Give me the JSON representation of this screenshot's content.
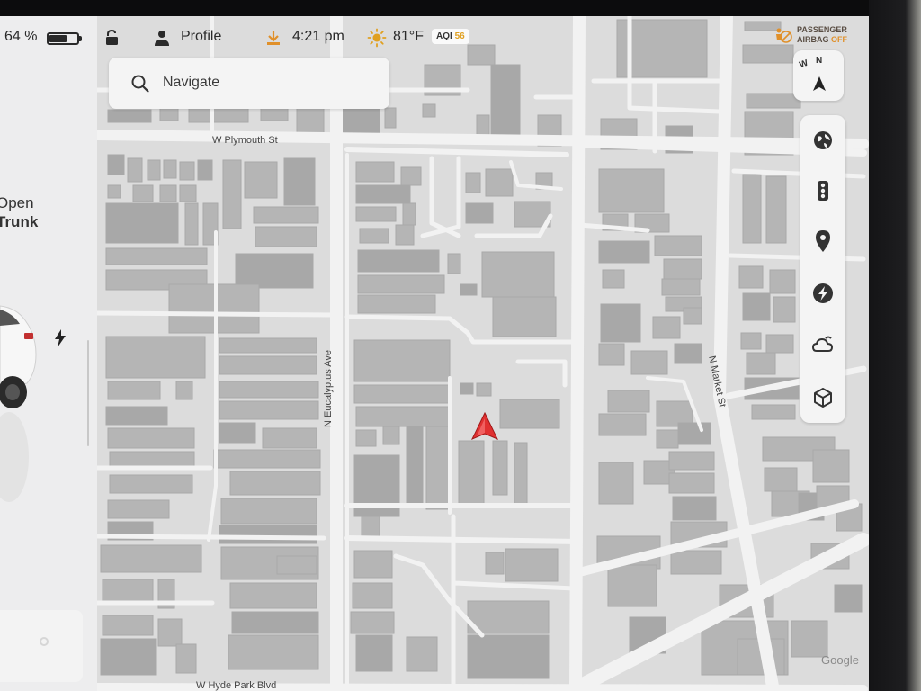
{
  "status": {
    "battery_text": "64 %",
    "battery_level": 0.64,
    "profile_label": "Profile",
    "time": "4:21 pm",
    "temperature": "81°F",
    "aqi_label": "AQI",
    "aqi_value": "56",
    "airbag_line1": "PASSENGER",
    "airbag_line2": "AIRBAG",
    "airbag_state": "OFF"
  },
  "left_panel": {
    "trunk_line1": "Open",
    "trunk_line2": "Trunk"
  },
  "search": {
    "placeholder": "Navigate"
  },
  "compass": {
    "letters": [
      "W",
      "N"
    ]
  },
  "map_streets": {
    "plymouth": "W Plymouth St",
    "eucalyptus": "N Eucalyptus Ave",
    "market": "N Market St",
    "hyde_park": "W Hyde Park Blvd"
  },
  "map_footer": {
    "attribution": "Google"
  },
  "colors": {
    "map_bg": "#dcdcdc",
    "road": "#f2f2f2",
    "building": "#b5b5b5",
    "building_dark": "#a8a8a8",
    "nav_arrow": "#e03030",
    "airbag_off": "#e0902a"
  },
  "icons": {
    "toolbar": [
      "globe-icon",
      "traffic-light-icon",
      "pin-icon",
      "charging-icon",
      "weather-icon",
      "cube-icon"
    ]
  }
}
